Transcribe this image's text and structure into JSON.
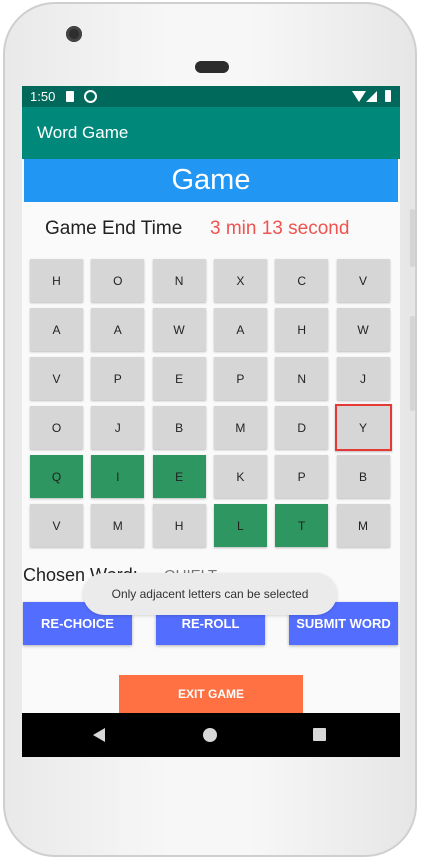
{
  "status_bar": {
    "time": "1:50"
  },
  "app_bar": {
    "title": "Word Game"
  },
  "game": {
    "header": "Game",
    "end_time_label": "Game End Time",
    "end_time_value": "3 min 13 second",
    "grid": [
      [
        "H",
        "O",
        "N",
        "X",
        "C",
        "V"
      ],
      [
        "A",
        "A",
        "W",
        "A",
        "H",
        "W"
      ],
      [
        "V",
        "P",
        "E",
        "P",
        "N",
        "J"
      ],
      [
        "O",
        "J",
        "B",
        "M",
        "D",
        "Y"
      ],
      [
        "Q",
        "I",
        "E",
        "K",
        "P",
        "B"
      ],
      [
        "V",
        "M",
        "H",
        "L",
        "T",
        "M"
      ]
    ],
    "selected_cells": [
      [
        4,
        0
      ],
      [
        4,
        1
      ],
      [
        4,
        2
      ],
      [
        5,
        3
      ],
      [
        5,
        4
      ]
    ],
    "highlighted_cell": [
      3,
      5
    ],
    "chosen_word_label": "Chosen Word:",
    "chosen_word_value": "QUIELT",
    "buttons": {
      "rechoice": "RE-CHOICE",
      "reroll": "RE-ROLL",
      "submit": "SUBMIT WORD",
      "exit": "EXIT GAME"
    },
    "toast": "Only adjacent letters can be selected"
  },
  "colors": {
    "status_bar": "#00695c",
    "app_bar": "#00897b",
    "header": "#2196f3",
    "cell": "#d6d6d6",
    "cell_selected": "#2e9660",
    "highlight_border": "#e53935",
    "end_time": "#ef5350",
    "action_button": "#536dfe",
    "exit_button": "#ff7043"
  }
}
